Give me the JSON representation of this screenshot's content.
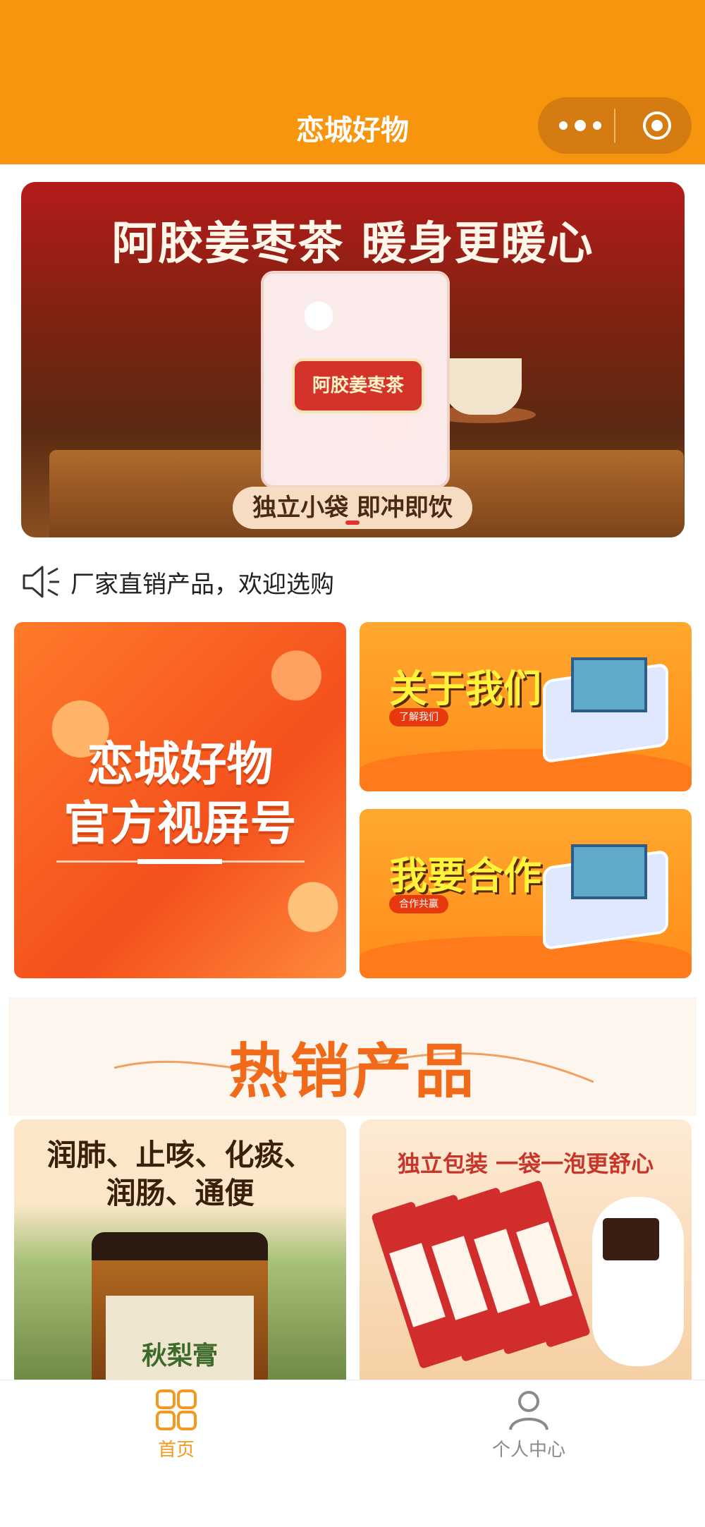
{
  "header": {
    "title": "恋城好物"
  },
  "banner": {
    "headline": "阿胶姜枣茶 暖身更暖心",
    "package_label": "阿胶姜枣茶",
    "tag": "独立小袋 即冲即饮"
  },
  "notice": {
    "text": "厂家直销产品，欢迎选购"
  },
  "promo": {
    "video": {
      "line1": "恋城好物",
      "line2": "官方视屏号"
    },
    "about": {
      "title": "关于我们",
      "pill": "了解我们"
    },
    "coop": {
      "title": "我要合作",
      "pill": "合作共赢"
    }
  },
  "hot": {
    "title": "热销产品"
  },
  "products": [
    {
      "title_line1": "润肺、止咳、化痰、",
      "title_line2": "润肠、通便",
      "jar_label": "秋梨膏"
    },
    {
      "title": "独立包装 一袋一泡更舒心"
    }
  ],
  "tabs": [
    {
      "label": "首页",
      "active": true,
      "icon": "grid-icon"
    },
    {
      "label": "个人中心",
      "active": false,
      "icon": "user-icon"
    }
  ],
  "colors": {
    "brand": "#f7960e",
    "active_tab": "#f39a1e",
    "hot_title": "#f06a1a"
  }
}
